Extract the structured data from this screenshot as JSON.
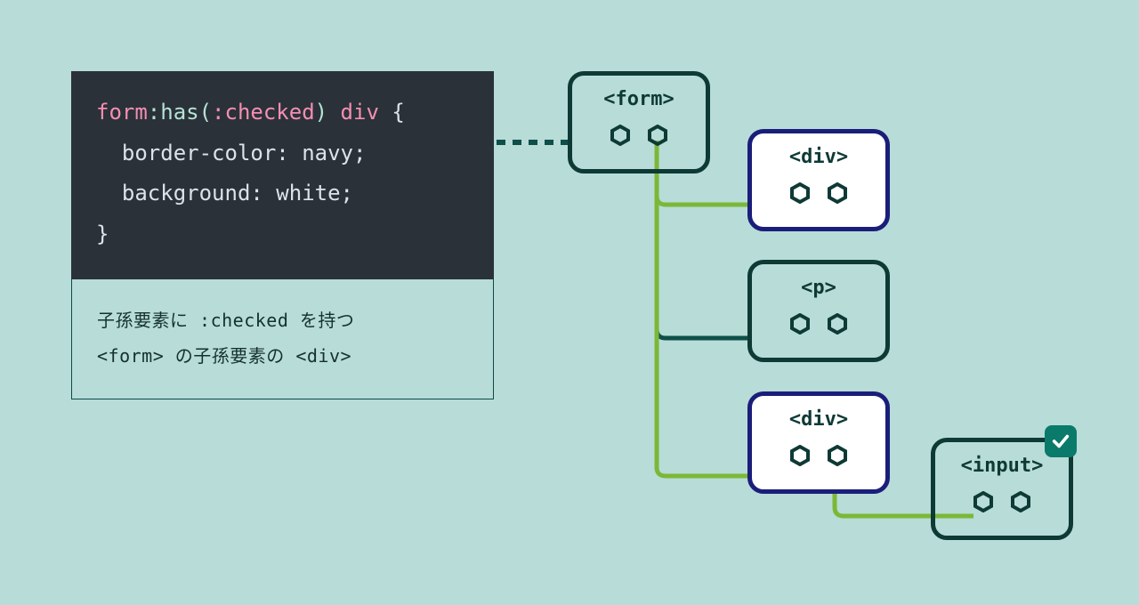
{
  "code": {
    "line1_sel_a": "form",
    "line1_sel_b": ":has(",
    "line1_sel_c": ":checked",
    "line1_sel_d": ")",
    "line1_sel_e": " div",
    "line1_brace": " {",
    "line2": "  border-color: navy;",
    "line3": "  background: white;",
    "line4": "}"
  },
  "explain": {
    "row1_a": "子孫要素に ",
    "row1_b": ":checked",
    "row1_c": " を持つ",
    "row2_a": "<form>",
    "row2_b": " の子孫要素の ",
    "row2_c": "<div>"
  },
  "nodes": {
    "form": "<form>",
    "div1": "<div>",
    "p": "<p>",
    "div2": "<div>",
    "input": "<input>"
  },
  "colors": {
    "bg": "#b8dcd7",
    "code_bg": "#2a3139",
    "node_dark": "#0e3a36",
    "node_sel_border": "#1a1e7a",
    "wire_green": "#7bb838",
    "wire_teal": "#0e4f4a",
    "badge": "#0a7a6a"
  }
}
